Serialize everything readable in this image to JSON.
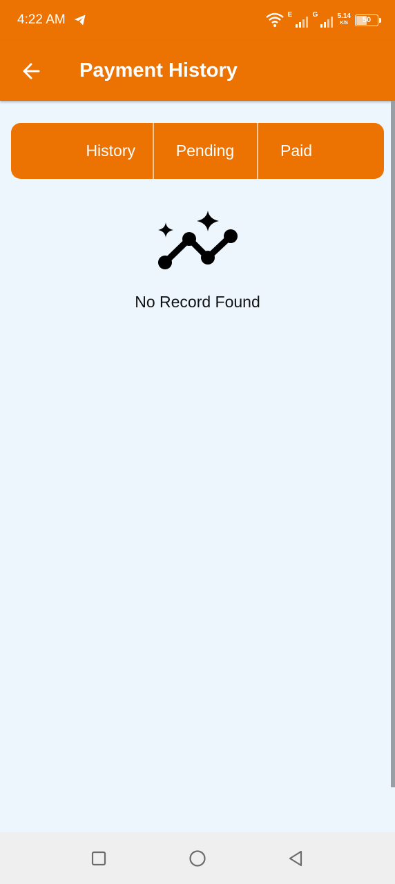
{
  "status_bar": {
    "time": "4:22 AM",
    "network_1": "E",
    "network_2": "G",
    "speed_value": "5.14",
    "speed_unit": "K/S",
    "battery": "50"
  },
  "app_bar": {
    "title": "Payment History",
    "back_icon": "arrow-left-icon"
  },
  "tabs": [
    {
      "label": "History"
    },
    {
      "label": "Pending"
    },
    {
      "label": "Paid"
    }
  ],
  "empty_state": {
    "icon": "trending-sparkle-icon",
    "message": "No Record Found"
  },
  "nav": {
    "recents_icon": "square-icon",
    "home_icon": "circle-icon",
    "back_icon": "triangle-back-icon"
  },
  "colors": {
    "primary": "#ec7202",
    "background": "#eef6fd",
    "nav_background": "#efefef"
  }
}
